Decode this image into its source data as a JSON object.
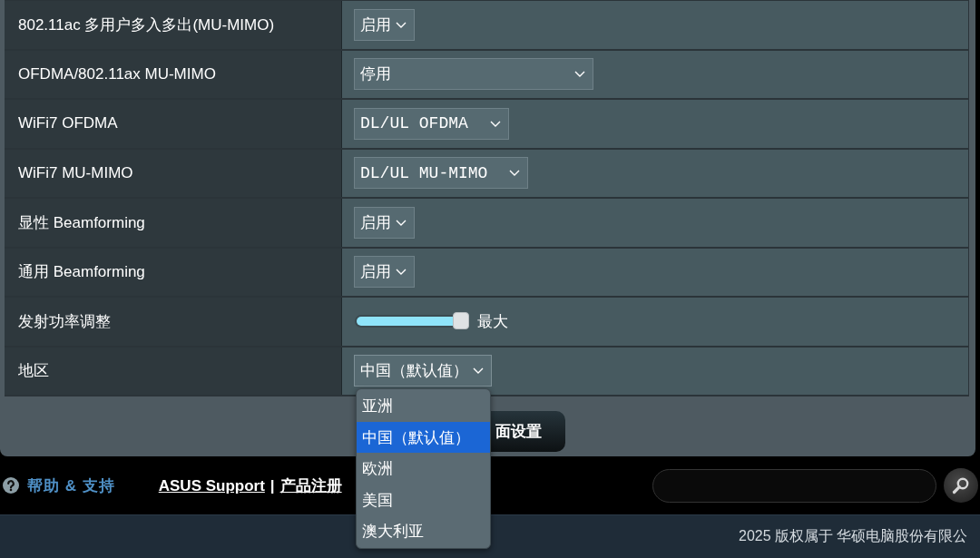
{
  "settings": [
    {
      "label": "802.11ac 多用户多入多出(MU-MIMO)",
      "kind": "select",
      "value": "启用",
      "expanded": false
    },
    {
      "label": "OFDMA/802.11ax MU-MIMO",
      "kind": "select",
      "value": "停用",
      "expanded": false
    },
    {
      "label": "WiFi7 OFDMA",
      "kind": "select",
      "value": "DL/UL OFDMA",
      "expanded": false
    },
    {
      "label": "WiFi7 MU-MIMO",
      "kind": "select",
      "value": "DL/UL MU-MIMO",
      "expanded": false
    },
    {
      "label": "显性 Beamforming",
      "kind": "select",
      "value": "启用",
      "expanded": false
    },
    {
      "label": "通用 Beamforming",
      "kind": "select",
      "value": "启用",
      "expanded": false
    },
    {
      "label": "发射功率调整",
      "kind": "slider",
      "level": 1,
      "reading": "最大"
    },
    {
      "label": "地区",
      "kind": "select",
      "value": "中国（默认值）",
      "expanded": true,
      "options": [
        {
          "label": "亚洲",
          "selected": false
        },
        {
          "label": "中国（默认值）",
          "selected": true
        },
        {
          "label": "欧洲",
          "selected": false
        },
        {
          "label": "美国",
          "selected": false
        },
        {
          "label": "澳大利亚",
          "selected": false
        }
      ]
    }
  ],
  "apply_button": {
    "label": "面设置"
  },
  "footer": {
    "help": "帮助 & 支持",
    "links": [
      "ASUS Support",
      "产品注册"
    ],
    "separator": "|"
  },
  "copyright": "2025 版权属于 华硕电脑股份有限公"
}
